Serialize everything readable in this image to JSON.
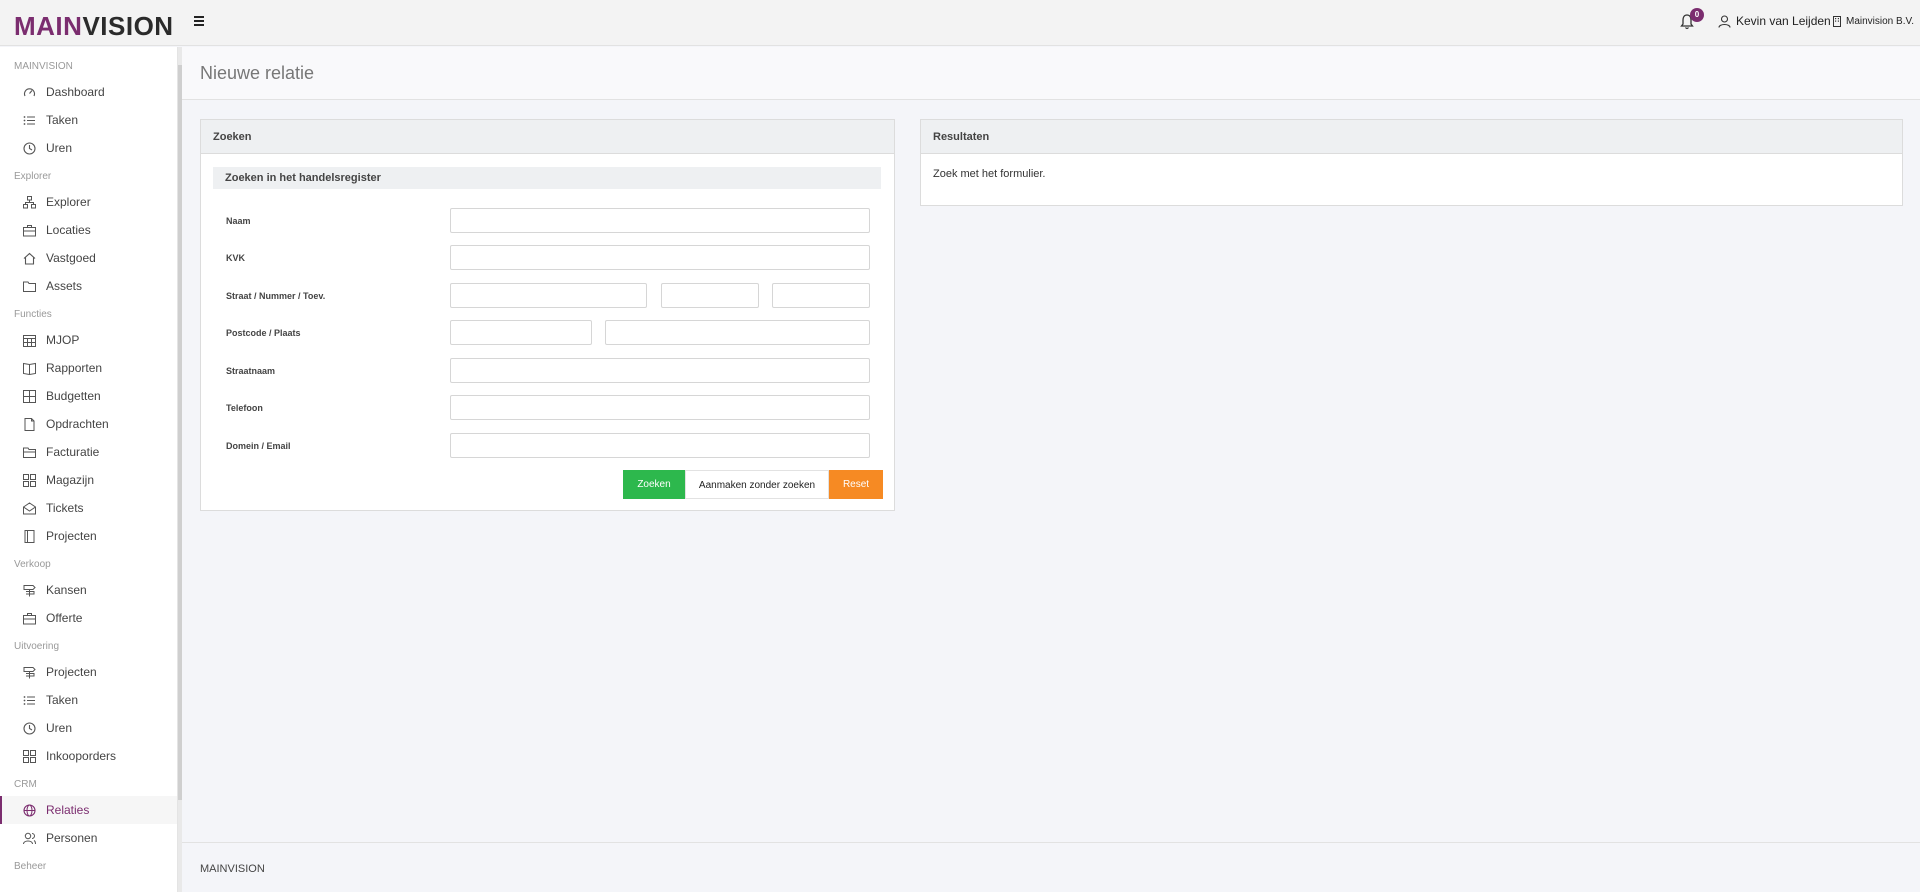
{
  "header": {
    "logo_part1": "MAIN",
    "logo_part2": "VISION",
    "notification_count": "0",
    "user_name": "Kevin van Leijden",
    "company_name": "Mainvision B.V."
  },
  "sidebar": {
    "sections": [
      {
        "title": "MAINVISION",
        "items": [
          {
            "label": "Dashboard",
            "icon": "dashboard-icon"
          },
          {
            "label": "Taken",
            "icon": "list-icon"
          },
          {
            "label": "Uren",
            "icon": "clock-icon"
          }
        ]
      },
      {
        "title": "Explorer",
        "items": [
          {
            "label": "Explorer",
            "icon": "sitemap-icon"
          },
          {
            "label": "Locaties",
            "icon": "briefcase-icon"
          },
          {
            "label": "Vastgoed",
            "icon": "home-icon"
          },
          {
            "label": "Assets",
            "icon": "folder-icon"
          }
        ]
      },
      {
        "title": "Functies",
        "items": [
          {
            "label": "MJOP",
            "icon": "calendar-icon"
          },
          {
            "label": "Rapporten",
            "icon": "book-icon"
          },
          {
            "label": "Budgetten",
            "icon": "calculator-icon"
          },
          {
            "label": "Opdrachten",
            "icon": "file-icon"
          },
          {
            "label": "Facturatie",
            "icon": "folder-open-icon"
          },
          {
            "label": "Magazijn",
            "icon": "grid-icon"
          },
          {
            "label": "Tickets",
            "icon": "envelope-open-icon"
          },
          {
            "label": "Projecten",
            "icon": "book-open-icon"
          }
        ]
      },
      {
        "title": "Verkoop",
        "items": [
          {
            "label": "Kansen",
            "icon": "signpost-icon"
          },
          {
            "label": "Offerte",
            "icon": "briefcase-icon"
          }
        ]
      },
      {
        "title": "Uitvoering",
        "items": [
          {
            "label": "Projecten",
            "icon": "signpost-icon"
          },
          {
            "label": "Taken",
            "icon": "list-icon"
          },
          {
            "label": "Uren",
            "icon": "clock-icon"
          },
          {
            "label": "Inkooporders",
            "icon": "grid-icon"
          }
        ]
      },
      {
        "title": "CRM",
        "items": [
          {
            "label": "Relaties",
            "icon": "globe-icon",
            "active": true
          },
          {
            "label": "Personen",
            "icon": "users-icon"
          }
        ]
      },
      {
        "title": "Beheer",
        "items": []
      }
    ]
  },
  "page": {
    "title": "Nieuwe relatie"
  },
  "search_panel": {
    "title": "Zoeken",
    "subtitle": "Zoeken in het handelsregister",
    "fields": {
      "naam": "Naam",
      "kvk": "KVK",
      "straat": "Straat / Nummer / Toev.",
      "postcode": "Postcode / Plaats",
      "straatnaam": "Straatnaam",
      "telefoon": "Telefoon",
      "domein": "Domein / Email"
    },
    "buttons": {
      "search": "Zoeken",
      "create": "Aanmaken zonder zoeken",
      "reset": "Reset"
    }
  },
  "results_panel": {
    "title": "Resultaten",
    "text": "Zoek met het formulier."
  },
  "footer": {
    "text": "MAINVISION"
  },
  "colors": {
    "brand": "#7b2d6f",
    "green": "#2db84d",
    "orange": "#f68a23"
  }
}
